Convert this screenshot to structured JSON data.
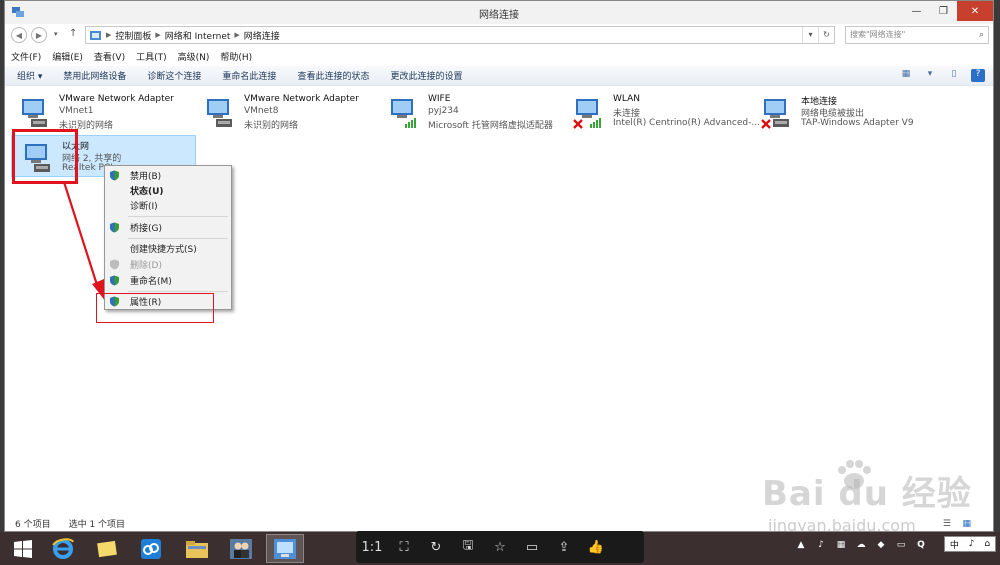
{
  "window": {
    "title": "网络连接",
    "controls": {
      "minimize": "—",
      "maximize": "❐",
      "close": "✕"
    }
  },
  "address": {
    "crumbs": [
      "控制面板",
      "网络和 Internet",
      "网络连接"
    ],
    "search_placeholder": "搜索\"网络连接\""
  },
  "menu": [
    "文件(F)",
    "编辑(E)",
    "查看(V)",
    "工具(T)",
    "高级(N)",
    "帮助(H)"
  ],
  "commands": [
    "组织 ▾",
    "禁用此网络设备",
    "诊断这个连接",
    "重命名此连接",
    "查看此连接的状态",
    "更改此连接的设置"
  ],
  "connections": [
    {
      "name": "VMware Network Adapter VMnet1",
      "line1": "VMware Network Adapter",
      "line2": "VMnet1",
      "status": "未识别的网络",
      "icon": "ethernet-adapter-icon"
    },
    {
      "name": "VMware Network Adapter VMnet8",
      "line1": "VMware Network Adapter",
      "line2": "VMnet8",
      "status": "未识别的网络",
      "icon": "ethernet-adapter-icon"
    },
    {
      "name": "WIFE",
      "line1": "WIFE",
      "line2": "pyj234",
      "status": "Microsoft 托管网络虚拟适配器",
      "icon": "wifi-adapter-icon"
    },
    {
      "name": "WLAN",
      "line1": "WLAN",
      "line2": "未连接",
      "status": "Intel(R) Centrino(R) Advanced-...",
      "icon": "wifi-disconnected-icon"
    },
    {
      "name": "本地连接",
      "line1": "本地连接",
      "line2": "网络电缆被拔出",
      "status": "TAP-Windows Adapter V9",
      "icon": "ethernet-disconnected-icon"
    },
    {
      "name": "以太网",
      "line1": "以太网",
      "line2": "网络 2, 共享的",
      "status": "Realtek PCIe",
      "icon": "ethernet-adapter-icon"
    }
  ],
  "context_menu": [
    {
      "label": "禁用(B)",
      "shield": true,
      "bold": false,
      "disabled": false
    },
    {
      "label": "状态(U)",
      "shield": false,
      "bold": true,
      "disabled": false
    },
    {
      "label": "诊断(I)",
      "shield": false,
      "bold": false,
      "disabled": false
    },
    {
      "label": "桥接(G)",
      "shield": true,
      "bold": false,
      "disabled": false
    },
    {
      "label": "创建快捷方式(S)",
      "shield": false,
      "bold": false,
      "disabled": false
    },
    {
      "label": "删除(D)",
      "shield": true,
      "bold": false,
      "disabled": true
    },
    {
      "label": "重命名(M)",
      "shield": true,
      "bold": false,
      "disabled": false
    },
    {
      "label": "属性(R)",
      "shield": true,
      "bold": false,
      "disabled": false
    }
  ],
  "status": {
    "count": "6 个项目",
    "selected": "选中 1 个项目"
  },
  "watermark": {
    "brand": "Bai du 经验",
    "url": "jingyan.baidu.com"
  },
  "viewer_toolbar": [
    "1:1",
    "⛶",
    "↻",
    "🖫",
    "☆",
    "▭",
    "⇪",
    "👍"
  ],
  "ime": [
    "中",
    "♪",
    "⌂"
  ],
  "colors": {
    "accent_red": "#e0141e",
    "selection": "#cce8ff",
    "taskbar": "#3c2f2f"
  }
}
